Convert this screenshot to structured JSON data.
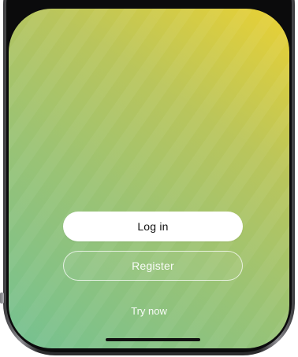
{
  "buttons": {
    "login_label": "Log in",
    "register_label": "Register"
  },
  "links": {
    "try_now_label": "Try now"
  },
  "colors": {
    "gradient_top_right": "#ead133",
    "gradient_bottom_left": "#74c192",
    "primary_button_bg": "#ffffff",
    "home_indicator": "#111111"
  }
}
